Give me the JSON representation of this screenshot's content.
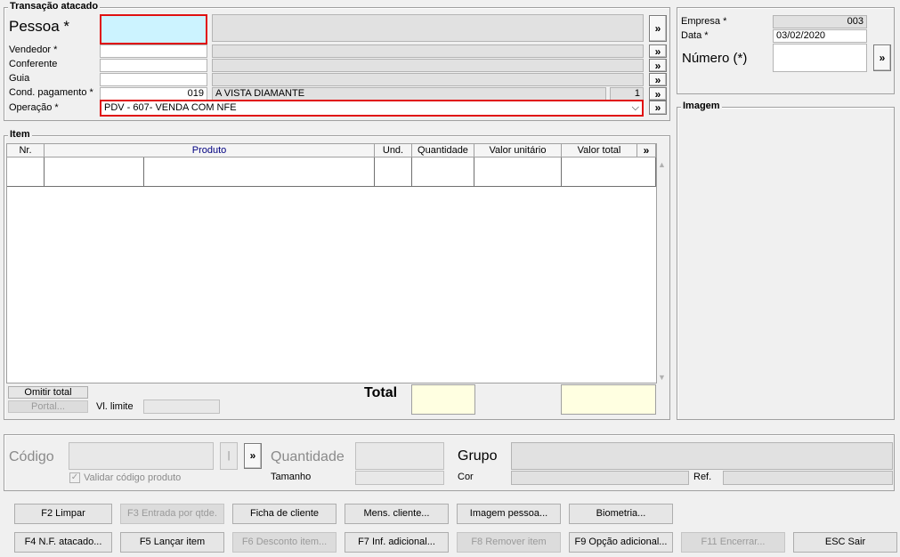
{
  "transacao": {
    "title": "Transação atacado",
    "pessoa_label": "Pessoa *",
    "pessoa_code": "",
    "pessoa_name": "",
    "vendedor_label": "Vendedor *",
    "conferente_label": "Conferente",
    "guia_label": "Guia",
    "cond_label": "Cond. pagamento *",
    "cond_code": "019",
    "cond_name": "A VISTA DIAMANTE",
    "cond_qty": "1",
    "operacao_label": "Operação *",
    "operacao_value": "PDV - 607- VENDA COM NFE",
    "more_glyph": "»",
    "dropdown_glyph": "⌵"
  },
  "header_right": {
    "empresa_label": "Empresa *",
    "empresa_value": "003",
    "data_label": "Data *",
    "data_value": "03/02/2020",
    "numero_label": "Número (*)",
    "numero_value": ""
  },
  "imagem": {
    "title": "Imagem"
  },
  "item": {
    "title": "Item",
    "columns": [
      "Nr.",
      "Produto",
      "Und.",
      "Quantidade",
      "Valor unitário",
      "Valor total",
      "»"
    ],
    "omitir_total": "Omitir total",
    "portal": "Portal...",
    "vl_limite_label": "Vl. limite",
    "total_label": "Total"
  },
  "entry": {
    "codigo_label": "Código",
    "quantidade_label": "Quantidade",
    "grupo_label": "Grupo",
    "validar_label": "Validar código produto",
    "tamanho_label": "Tamanho",
    "cor_label": "Cor",
    "ref_label": "Ref.",
    "separator": "|"
  },
  "buttons_row1": [
    {
      "label": "F2 Limpar",
      "enabled": true
    },
    {
      "label": "F3 Entrada por qtde.",
      "enabled": false
    },
    {
      "label": "Ficha de cliente",
      "enabled": true
    },
    {
      "label": "Mens. cliente...",
      "enabled": true
    },
    {
      "label": "Imagem pessoa...",
      "enabled": true
    },
    {
      "label": "Biometria...",
      "enabled": true
    }
  ],
  "buttons_row2": [
    {
      "label": "F4 N.F. atacado...",
      "enabled": true
    },
    {
      "label": "F5 Lançar item",
      "enabled": true
    },
    {
      "label": "F6 Desconto item...",
      "enabled": false
    },
    {
      "label": "F7 Inf. adicional...",
      "enabled": true
    },
    {
      "label": "F8 Remover item",
      "enabled": false
    },
    {
      "label": "F9 Opção adicional...",
      "enabled": true
    },
    {
      "label": "F11 Encerrar...",
      "enabled": false
    },
    {
      "label": "ESC Sair",
      "enabled": true
    }
  ]
}
